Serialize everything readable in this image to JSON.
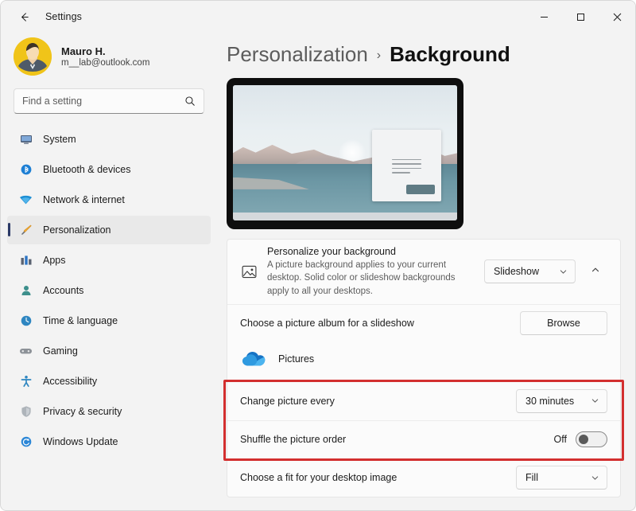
{
  "window": {
    "title": "Settings",
    "back_icon": "back-arrow-icon",
    "minimize_label": "Minimize",
    "maximize_label": "Maximize",
    "close_label": "Close"
  },
  "account": {
    "name": "Mauro H.",
    "email": "m__lab@outlook.com",
    "avatar_color": "#f0c419"
  },
  "search": {
    "placeholder": "Find a setting",
    "value": "",
    "icon": "search-icon"
  },
  "sidebar": {
    "items": [
      {
        "label": "System",
        "icon": "monitor-icon",
        "selected": false
      },
      {
        "label": "Bluetooth & devices",
        "icon": "bluetooth-icon",
        "selected": false
      },
      {
        "label": "Network & internet",
        "icon": "wifi-icon",
        "selected": false
      },
      {
        "label": "Personalization",
        "icon": "paintbrush-icon",
        "selected": true
      },
      {
        "label": "Apps",
        "icon": "apps-grid-icon",
        "selected": false
      },
      {
        "label": "Accounts",
        "icon": "person-icon",
        "selected": false
      },
      {
        "label": "Time & language",
        "icon": "clock-globe-icon",
        "selected": false
      },
      {
        "label": "Gaming",
        "icon": "gamepad-icon",
        "selected": false
      },
      {
        "label": "Accessibility",
        "icon": "accessibility-icon",
        "selected": false
      },
      {
        "label": "Privacy & security",
        "icon": "shield-icon",
        "selected": false
      },
      {
        "label": "Windows Update",
        "icon": "update-sync-icon",
        "selected": false
      }
    ],
    "accent_color": "#2b3a67"
  },
  "breadcrumb": {
    "parent": "Personalization",
    "separator": "›",
    "current": "Background"
  },
  "preview": {
    "name": "desktop-background-preview",
    "description": "Monitor preview showing mountain lake wallpaper with a sample window"
  },
  "settings": {
    "personalize": {
      "title": "Personalize your background",
      "description": "A picture background applies to your current desktop. Solid color or slideshow backgrounds apply to all your desktops.",
      "icon": "picture-icon",
      "selected_option": "Slideshow",
      "expander_icon": "chevron-up-icon",
      "chevron_icon": "chevron-down-icon"
    },
    "album": {
      "title": "Choose a picture album for a slideshow",
      "browse_label": "Browse",
      "folder_name": "Pictures",
      "folder_icon": "onedrive-cloud-icon"
    },
    "change_interval": {
      "title": "Change picture every",
      "selected_option": "30 minutes",
      "chevron_icon": "chevron-down-icon"
    },
    "shuffle": {
      "title": "Shuffle the picture order",
      "state_label": "Off",
      "enabled": false
    },
    "fit": {
      "title": "Choose a fit for your desktop image",
      "selected_option": "Fill",
      "chevron_icon": "chevron-down-icon"
    }
  },
  "annotation": {
    "highlight_color": "#d32f2f",
    "label": "highlighted-settings-region"
  }
}
